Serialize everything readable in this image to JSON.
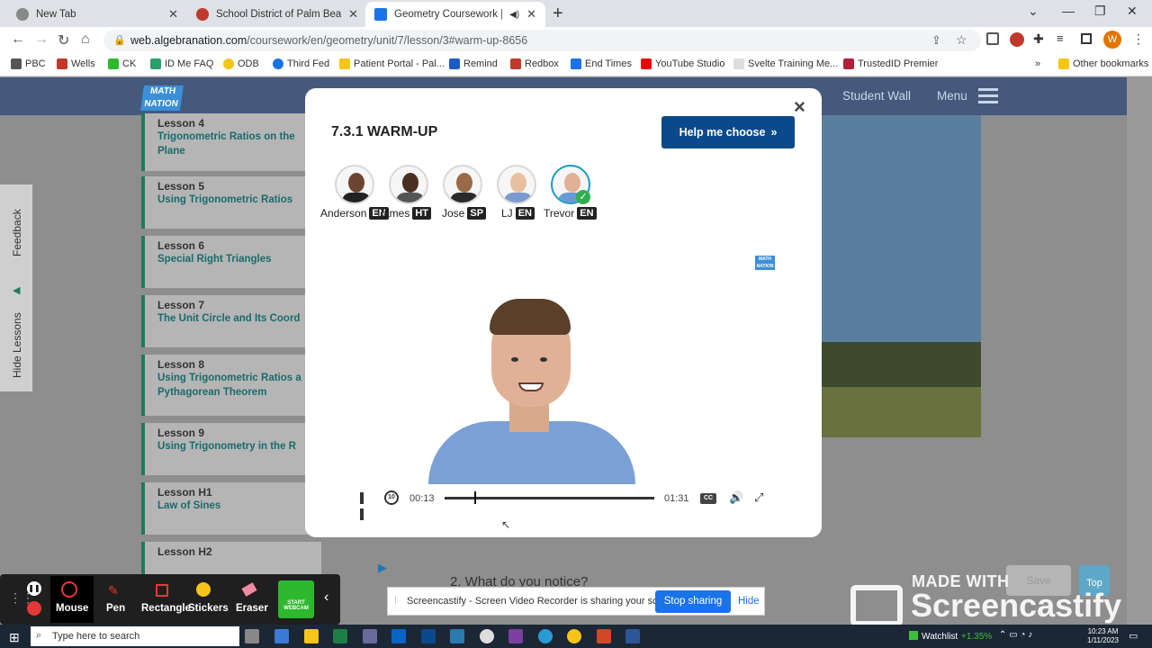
{
  "browser": {
    "tabs": [
      {
        "label": "New Tab",
        "active": false
      },
      {
        "label": "School District of Palm Beach Co",
        "active": false
      },
      {
        "label": "Geometry Coursework | Unit",
        "active": true
      }
    ],
    "url_host": "web.algebranation.com",
    "url_path": "/coursework/en/geometry/unit/7/lesson/3#warm-up-8656",
    "bookmarks": [
      "PBC",
      "Wells",
      "CK",
      "ID Me FAQ",
      "ODB",
      "Third Fed",
      "Patient Portal - Pal...",
      "Remind",
      "Redbox",
      "End Times",
      "YouTube Studio",
      "Svelte Training Me...",
      "TrustedID Premier"
    ],
    "other_bookmarks": "Other bookmarks",
    "more_bookmarks": "»",
    "profile_initial": "W"
  },
  "site": {
    "logo": "MATH NATION",
    "nav": {
      "student_wall": "Student Wall",
      "menu": "Menu"
    },
    "side": {
      "feedback": "Feedback",
      "hide_lessons": "Hide Lessons"
    },
    "lessons": [
      {
        "num": "Lesson 4",
        "name": "Trigonometric Ratios on the Plane"
      },
      {
        "num": "Lesson 5",
        "name": "Using Trigonometric Ratios"
      },
      {
        "num": "Lesson 6",
        "name": "Special Right Triangles"
      },
      {
        "num": "Lesson 7",
        "name": "The Unit Circle and Its Coord"
      },
      {
        "num": "Lesson 8",
        "name": "Using Trigonometric Ratios a Pythagorean Theorem"
      },
      {
        "num": "Lesson 9",
        "name": "Using Trigonometry in the R"
      },
      {
        "num": "Lesson H1",
        "name": "Law of Sines"
      },
      {
        "num": "Lesson H2",
        "name": ""
      }
    ],
    "question": "2. What do you notice?",
    "save": "Save",
    "top": "Top"
  },
  "modal": {
    "title": "7.3.1 WARM-UP",
    "help_button": "Help me choose",
    "close": "×",
    "tutors": [
      {
        "name": "Anderson",
        "lang": "EN",
        "skin": "#6b4530",
        "shirt": "#222"
      },
      {
        "name": "James",
        "lang": "HT",
        "skin": "#4a3020",
        "shirt": "#555"
      },
      {
        "name": "Jose",
        "lang": "SP",
        "skin": "#9a6a48",
        "shirt": "#2a2a2a"
      },
      {
        "name": "LJ",
        "lang": "EN",
        "skin": "#e8c0a0",
        "shirt": "#7a9ad0"
      },
      {
        "name": "Trevor",
        "lang": "EN",
        "skin": "#e0b196",
        "shirt": "#6a9ad6"
      }
    ],
    "selected_tutor": "Trevor",
    "video_logo": "MATH NATION",
    "video": {
      "current_time": "00:13",
      "duration": "01:31",
      "progress": 0.143,
      "cc": "CC"
    }
  },
  "recorder": {
    "tools": [
      "Mouse",
      "Pen",
      "Rectangle",
      "Stickers",
      "Eraser"
    ],
    "webcam": "START WEBCAM",
    "share_text": "Screencastify - Screen Video Recorder is sharing your screen.",
    "stop_sharing": "Stop sharing",
    "hide": "Hide",
    "made_with": "MADE WITH",
    "brand": "Screencastify"
  },
  "taskbar": {
    "search_placeholder": "Type here to search",
    "watchlist": "Watchlist",
    "watch_change": "+1.35%",
    "time": "10:23 AM",
    "date": "1/11/2023"
  }
}
